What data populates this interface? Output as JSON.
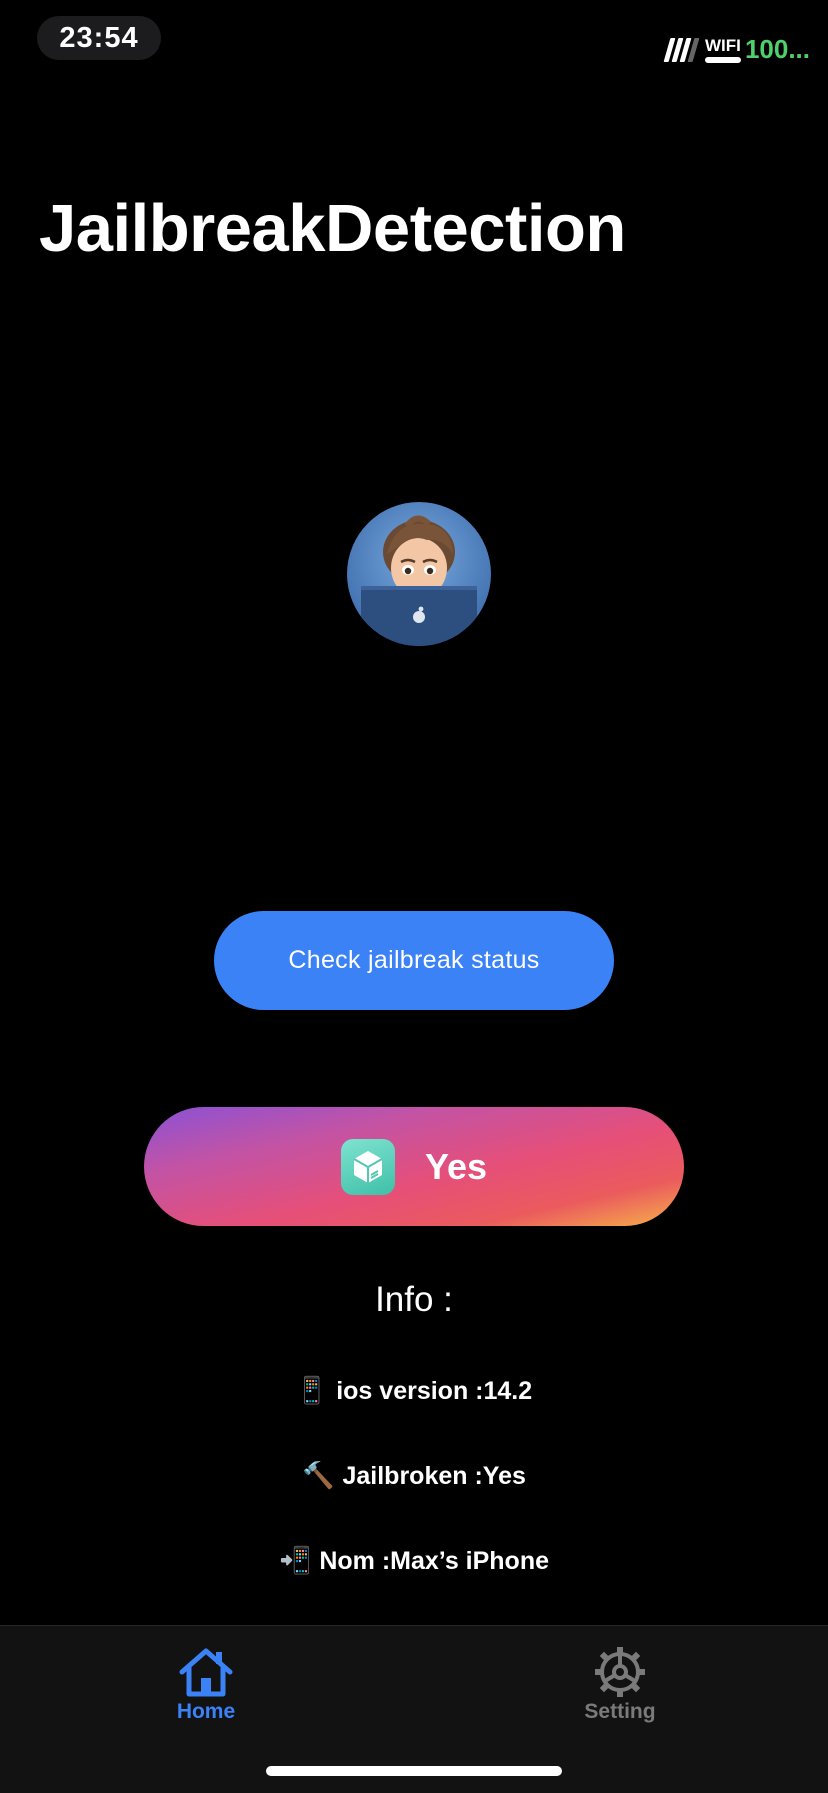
{
  "status_bar": {
    "time": "23:54",
    "network": "WIFI",
    "battery": "100..."
  },
  "page": {
    "title": "JailbreakDetection"
  },
  "avatar": {
    "icon": "memoji-avatar"
  },
  "actions": {
    "check_label": "Check jailbreak status",
    "result_label": "Yes",
    "result_icon": "package-manager-app-icon"
  },
  "info": {
    "heading": "Info :",
    "lines": [
      {
        "emoji": "📱",
        "text": "ios version :14.2"
      },
      {
        "emoji": "🔨",
        "text": "Jailbroken :Yes"
      },
      {
        "emoji": "📲",
        "text": "Nom :Max’s iPhone"
      }
    ]
  },
  "tabs": [
    {
      "label": "Home",
      "icon": "home-icon",
      "active": true
    },
    {
      "label": "Setting",
      "icon": "settings-icon",
      "active": false
    }
  ],
  "colors": {
    "accent": "#3b82f6",
    "battery": "#4fd06a",
    "inactive_tab": "#7a7a7a"
  }
}
